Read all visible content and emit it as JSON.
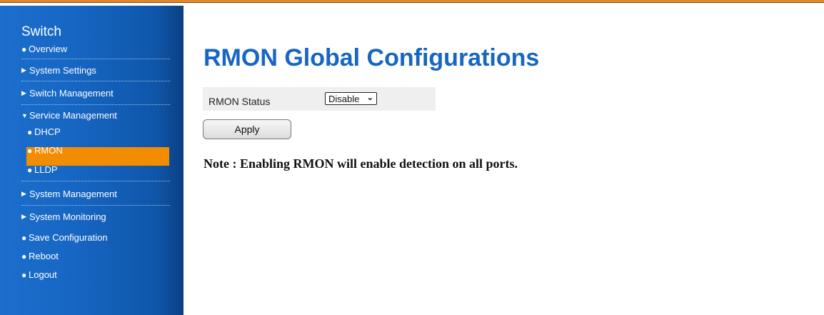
{
  "sidebar": {
    "brand": "Switch",
    "items": [
      {
        "label": "Overview",
        "icon": "bullet"
      },
      {
        "label": "System Settings",
        "icon": "triangle-right"
      },
      {
        "label": "Switch Management",
        "icon": "triangle-right"
      },
      {
        "label": "Service Management",
        "icon": "triangle-down"
      },
      {
        "label": "DHCP",
        "icon": "bullet"
      },
      {
        "label": "RMON",
        "icon": "bullet"
      },
      {
        "label": "LLDP",
        "icon": "bullet"
      },
      {
        "label": "System Management",
        "icon": "triangle-right"
      },
      {
        "label": "System Monitoring",
        "icon": "triangle-right"
      },
      {
        "label": "Save Configuration",
        "icon": "bullet"
      },
      {
        "label": "Reboot",
        "icon": "bullet"
      },
      {
        "label": "Logout",
        "icon": "bullet"
      }
    ],
    "active_item": "RMON"
  },
  "main": {
    "title": "RMON Global Configurations",
    "rmon_status_label": "RMON Status",
    "rmon_status_value": "Disable",
    "apply_label": "Apply",
    "note": "Note : Enabling RMON will enable detection on all ports."
  },
  "colors": {
    "sidebar_bg": "#1666c3",
    "active_bg": "#f28c00",
    "title": "#1666c3",
    "top_border": "#e2862a"
  }
}
